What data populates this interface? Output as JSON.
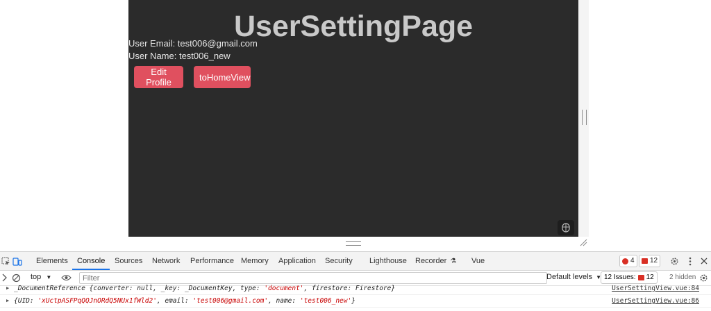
{
  "app": {
    "title": "UserSettingPage",
    "user_email_line": "User Email: test006@gmail.com",
    "user_name_line": "User Name: test006_new",
    "edit_profile_label": "Edit Profile",
    "to_home_label": "toHomeView"
  },
  "devtools": {
    "tabs": [
      {
        "label": "Elements"
      },
      {
        "label": "Console",
        "active": true
      },
      {
        "label": "Sources"
      },
      {
        "label": "Network"
      },
      {
        "label": "Performance"
      },
      {
        "label": "Memory"
      },
      {
        "label": "Application"
      },
      {
        "label": "Security"
      },
      {
        "label": "Lighthouse"
      },
      {
        "label": "Recorder"
      },
      {
        "label": "Vue"
      }
    ],
    "error_count": "4",
    "issue_count": "12",
    "context": "top",
    "filter_placeholder": "Filter",
    "levels_label": "Default levels",
    "issues_label": "12 Issues:",
    "issues_badge": "12",
    "hidden_label": "2 hidden",
    "logs": [
      {
        "prefix": "_DocumentReference {converter: null, _key: _DocumentKey, type: ",
        "str1": "'document'",
        "suffix": ", firestore: Firestore}",
        "source": "UserSettingView.vue:84"
      },
      {
        "prefix": "{UID: ",
        "str1": "'xUctpASFPqQQJnORdQ5NUx1fWld2'",
        "mid1": ", email: ",
        "str2": "'test006@gmail.com'",
        "mid2": ", name: ",
        "str3": "'test006_new'",
        "suffix": "}",
        "source": "UserSettingView.vue:86"
      }
    ]
  }
}
